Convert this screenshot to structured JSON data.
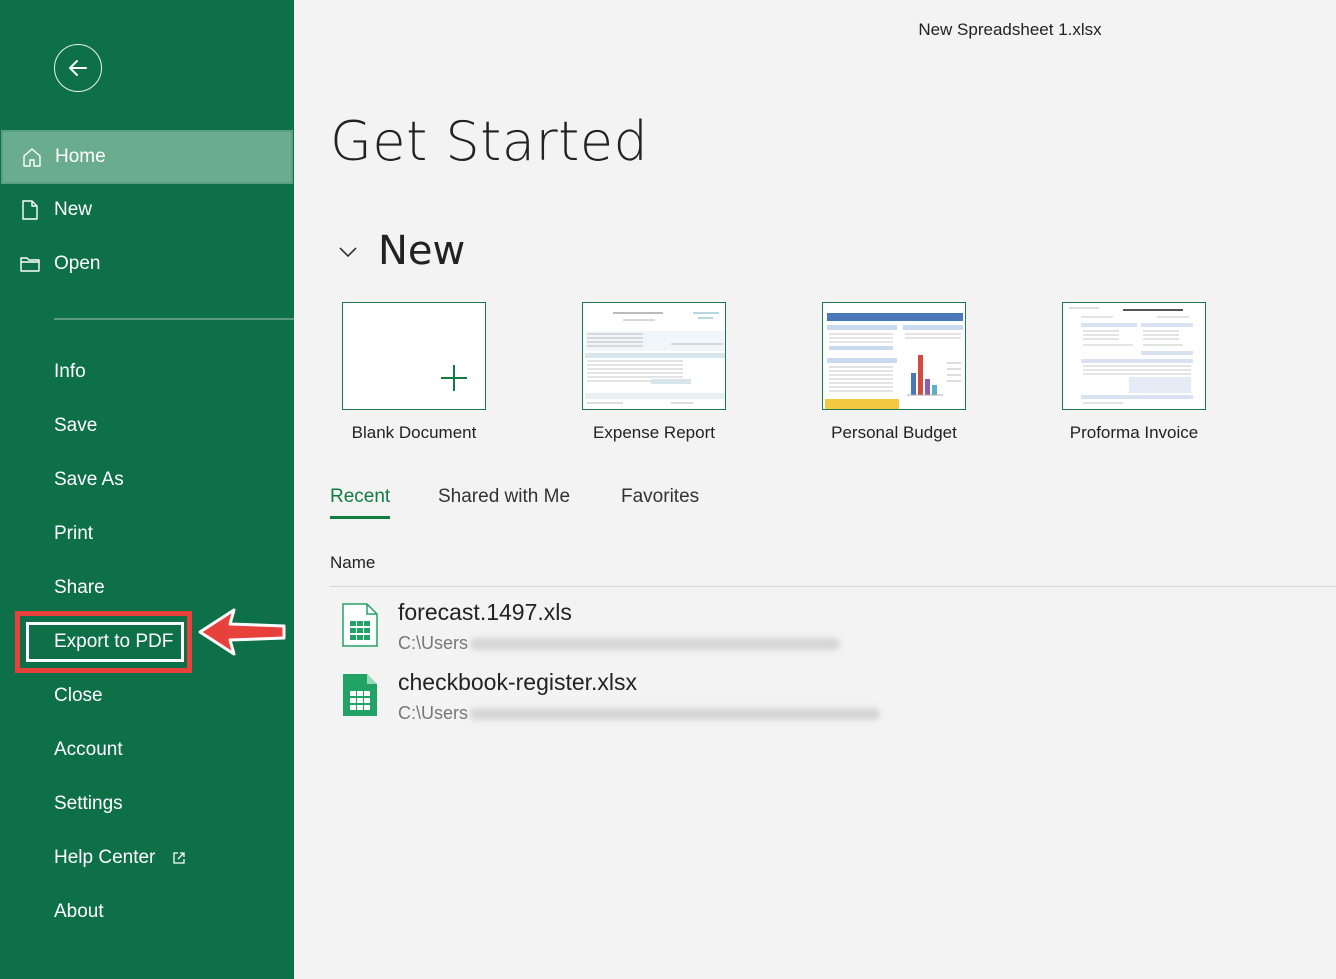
{
  "window": {
    "title": "New Spreadsheet 1.xlsx"
  },
  "sidebar": {
    "items": [
      {
        "label": "Home",
        "icon": "home-icon"
      },
      {
        "label": "New",
        "icon": "new-document-icon"
      },
      {
        "label": "Open",
        "icon": "folder-icon"
      },
      {
        "label": "Info"
      },
      {
        "label": "Save"
      },
      {
        "label": "Save As"
      },
      {
        "label": "Print"
      },
      {
        "label": "Share"
      },
      {
        "label": "Export to PDF"
      },
      {
        "label": "Close"
      },
      {
        "label": "Account"
      },
      {
        "label": "Settings"
      },
      {
        "label": "Help Center",
        "icon": "external-link-icon"
      },
      {
        "label": "About"
      }
    ],
    "active_item": "Home",
    "highlighted_item": "Export to PDF"
  },
  "main": {
    "heading": "Get Started",
    "new_section": {
      "title": "New",
      "templates": [
        {
          "label": "Blank Document"
        },
        {
          "label": "Expense Report"
        },
        {
          "label": "Personal Budget"
        },
        {
          "label": "Proforma Invoice"
        }
      ]
    },
    "tabs": [
      {
        "label": "Recent"
      },
      {
        "label": "Shared with Me"
      },
      {
        "label": "Favorites"
      }
    ],
    "active_tab": "Recent",
    "file_list": {
      "column_header": "Name",
      "files": [
        {
          "name": "forecast.1497.xls",
          "path_visible": "C:\\Users"
        },
        {
          "name": "checkbook-register.xlsx",
          "path_visible": "C:\\Users"
        }
      ]
    }
  },
  "colors": {
    "sidebar_bg": "#0e7048",
    "active_item_bg": "#6aad8e",
    "accent": "#107c41",
    "highlight_annotation": "#e8403a"
  }
}
